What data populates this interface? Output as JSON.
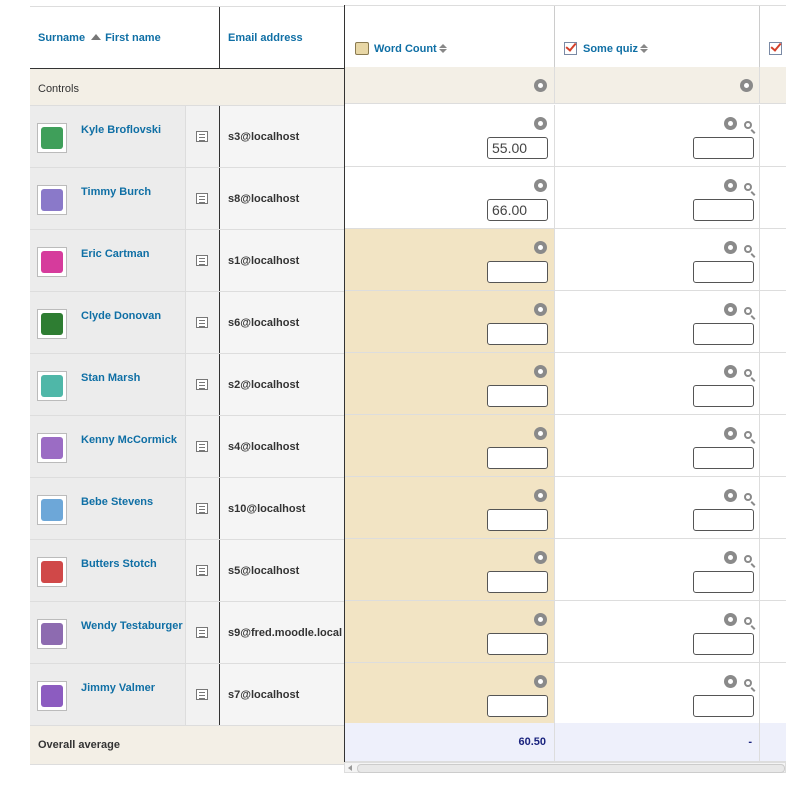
{
  "header": {
    "surname": "Surname",
    "first_name": "First name",
    "email": "Email address",
    "items": [
      {
        "label": "Word Count",
        "icon": "assignment-icon"
      },
      {
        "label": "Some quiz",
        "icon": "quiz-icon"
      }
    ]
  },
  "controls_label": "Controls",
  "overall_average": {
    "label": "Overall average",
    "values": [
      "60.50",
      "-"
    ]
  },
  "users": [
    {
      "name": "Kyle Broflovski",
      "email": "s3@localhost",
      "grade": "55.00",
      "avatar": "#3f9f5a"
    },
    {
      "name": "Timmy Burch",
      "email": "s8@localhost",
      "grade": "66.00",
      "avatar": "#8a79c9"
    },
    {
      "name": "Eric Cartman",
      "email": "s1@localhost",
      "grade": "",
      "avatar": "#d63b9c"
    },
    {
      "name": "Clyde Donovan",
      "email": "s6@localhost",
      "grade": "",
      "avatar": "#2e7d32"
    },
    {
      "name": "Stan Marsh",
      "email": "s2@localhost",
      "grade": "",
      "avatar": "#4fb7a8"
    },
    {
      "name": "Kenny McCormick",
      "email": "s4@localhost",
      "grade": "",
      "avatar": "#9b6cc4"
    },
    {
      "name": "Bebe Stevens",
      "email": "s10@localhost",
      "grade": "",
      "avatar": "#6da7d8"
    },
    {
      "name": "Butters Stotch",
      "email": "s5@localhost",
      "grade": "",
      "avatar": "#d04848"
    },
    {
      "name": "Wendy Testaburger",
      "email": "s9@fred.moodle.local",
      "grade": "",
      "avatar": "#8d6bb0"
    },
    {
      "name": "Jimmy Valmer",
      "email": "s7@localhost",
      "grade": "",
      "avatar": "#8c5cc0"
    }
  ]
}
